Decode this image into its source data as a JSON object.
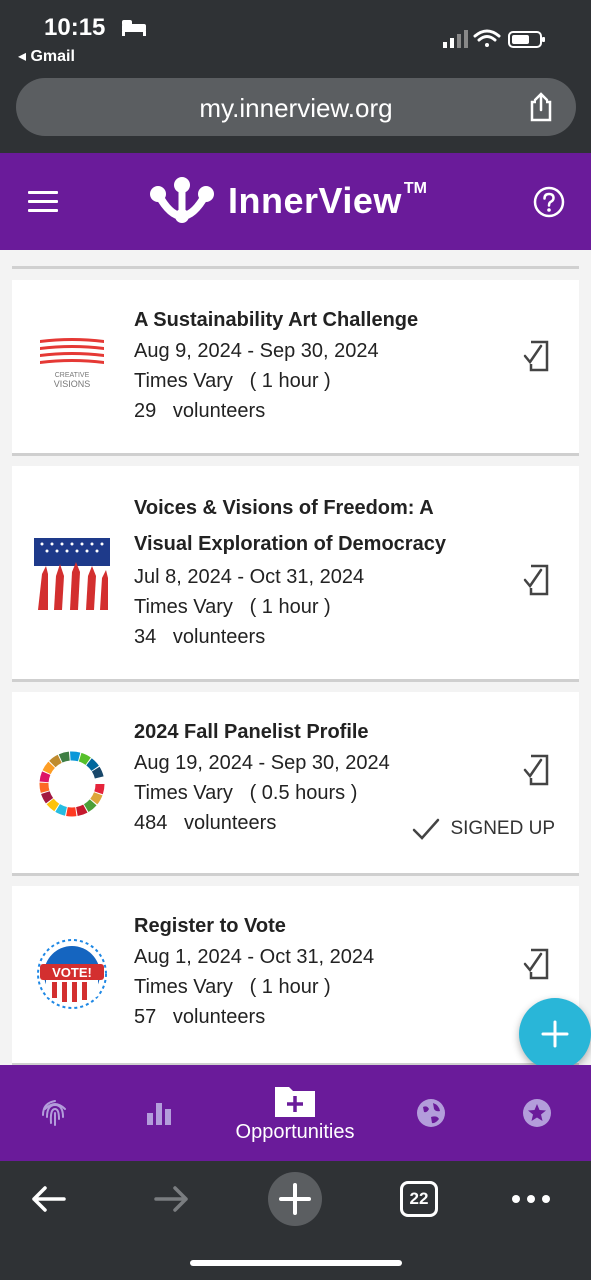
{
  "status_bar": {
    "time": "10:15",
    "back_app": "◂ Gmail"
  },
  "browser": {
    "url": "my.innerview.org",
    "tabs_count": "22"
  },
  "header": {
    "brand": "InnerView",
    "trademark": "TM"
  },
  "opportunities": [
    {
      "title": "A Sustainability Art Challenge",
      "dates": "Aug 9, 2024 - Sep 30, 2024",
      "times": "Times Vary   ( 1 hour )",
      "volunteers": "29   volunteers",
      "logo": "creative-visions-logo",
      "logo_text": "CREATIVE VISIONS"
    },
    {
      "title": "Voices & Visions of Freedom: A Visual Exploration of Democracy",
      "dates": "Jul 8, 2024 - Oct 31, 2024",
      "times": "Times Vary   ( 1 hour )",
      "volunteers": "34   volunteers",
      "logo": "flag-hands-logo"
    },
    {
      "title": "2024 Fall Panelist Profile",
      "dates": "Aug 19, 2024 - Sep 30, 2024",
      "times": "Times Vary   ( 0.5 hours )",
      "volunteers": "484   volunteers",
      "status": "SIGNED UP",
      "logo": "sdg-wheel-logo"
    },
    {
      "title": "Register to Vote",
      "dates": "Aug 1, 2024 - Oct 31, 2024",
      "times": "Times Vary   ( 1 hour )",
      "volunteers": "57   volunteers",
      "logo": "vote-badge-logo",
      "logo_text": "VOTE!"
    }
  ],
  "bottom_nav": [
    {
      "icon": "fingerprint-icon"
    },
    {
      "icon": "bar-chart-icon"
    },
    {
      "icon": "folder-plus-icon",
      "label": "Opportunities",
      "active": true
    },
    {
      "icon": "globe-icon"
    },
    {
      "icon": "star-badge-icon"
    }
  ],
  "colors": {
    "brand_purple": "#6a1b9a",
    "fab_cyan": "#29b6d8",
    "chrome_dark": "#2f3235"
  }
}
